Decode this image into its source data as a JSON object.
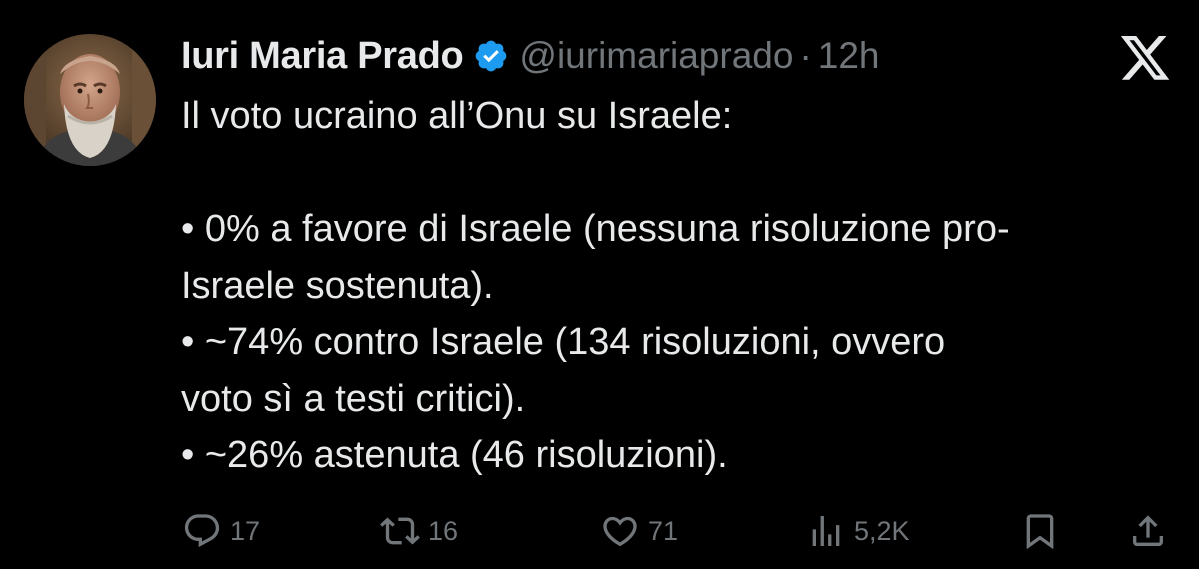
{
  "author": {
    "display_name": "Iuri Maria Prado",
    "handle": "@iurimariaprado",
    "separator": "·",
    "time": "12h",
    "verified": true
  },
  "tweet": {
    "lines": [
      "Il voto ucraino all’Onu su Israele:",
      "",
      "• 0% a favore di Israele (nessuna risoluzione pro-",
      "Israele sostenuta).",
      "• ~74% contro Israele (134 risoluzioni, ovvero",
      "voto sì a testi critici).",
      "• ~26% astenuta (46 risoluzioni)."
    ]
  },
  "actions": {
    "replies": "17",
    "reposts": "16",
    "likes": "71",
    "views": "5,2K"
  },
  "icons": {
    "verified": "verified-badge-icon",
    "platform": "x-logo-icon",
    "reply": "reply-icon",
    "repost": "repost-icon",
    "like": "heart-icon",
    "views": "views-icon",
    "bookmark": "bookmark-icon",
    "share": "share-icon"
  },
  "colors": {
    "background": "#000000",
    "text": "#e7e9ea",
    "secondary": "#71767b",
    "verified": "#1d9bf0"
  }
}
